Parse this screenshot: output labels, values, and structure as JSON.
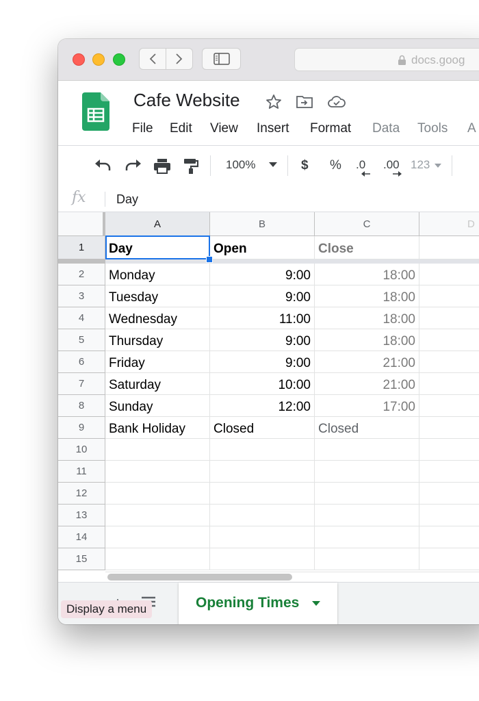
{
  "browser": {
    "url": "docs.goog"
  },
  "doc": {
    "title": "Cafe Website",
    "menu": [
      "File",
      "Edit",
      "View",
      "Insert",
      "Format",
      "Data",
      "Tools",
      "A"
    ]
  },
  "toolbar": {
    "zoom": "100%",
    "currency": "$",
    "percent": "%",
    "dec_decrease": ".0",
    "dec_increase": ".00",
    "more_formats": "123"
  },
  "formula_bar": {
    "fx": "fx",
    "value": "Day"
  },
  "grid": {
    "columns": [
      "A",
      "B",
      "C",
      "D"
    ],
    "row_numbers": [
      "1",
      "2",
      "3",
      "4",
      "5",
      "6",
      "7",
      "8",
      "9",
      "10",
      "11",
      "12",
      "13",
      "14",
      "15"
    ],
    "header": [
      "Day",
      "Open",
      "Close"
    ],
    "rows": [
      [
        "Monday",
        "9:00",
        "18:00"
      ],
      [
        "Tuesday",
        "9:00",
        "18:00"
      ],
      [
        "Wednesday",
        "11:00",
        "18:00"
      ],
      [
        "Thursday",
        "9:00",
        "18:00"
      ],
      [
        "Friday",
        "9:00",
        "21:00"
      ],
      [
        "Saturday",
        "10:00",
        "21:00"
      ],
      [
        "Sunday",
        "12:00",
        "17:00"
      ],
      [
        "Bank Holiday",
        "Closed",
        "Closed"
      ]
    ]
  },
  "sheets": {
    "tooltip": "Display a menu",
    "active_tab": "Opening Times",
    "accent_color": "#188038"
  }
}
